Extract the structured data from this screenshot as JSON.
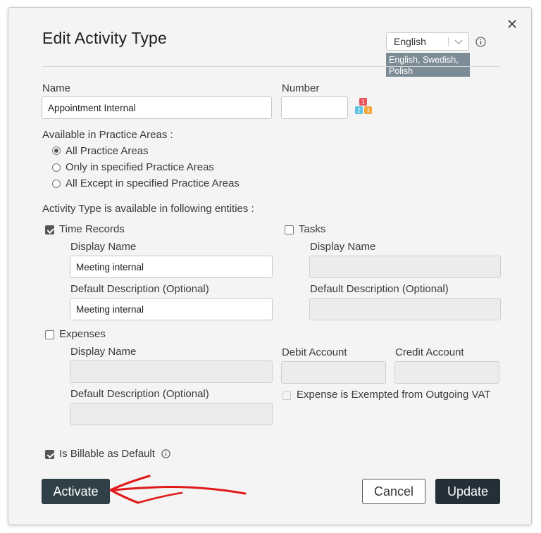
{
  "dialog": {
    "title": "Edit Activity Type",
    "language": {
      "selected": "English",
      "tooltip": "English, Swedish, Polish"
    },
    "name": {
      "label": "Name",
      "value": "Appointment Internal"
    },
    "number": {
      "label": "Number",
      "value": ""
    },
    "practice_areas": {
      "label": "Available in Practice Areas :",
      "options": [
        "All Practice Areas",
        "Only in specified Practice Areas",
        "All Except in specified Practice Areas"
      ],
      "selected_index": 0
    },
    "entities_label": "Activity Type is available in following entities :",
    "time_records": {
      "label": "Time Records",
      "checked": true,
      "display_name_label": "Display Name",
      "display_name_value": "Meeting internal",
      "default_desc_label": "Default Description (Optional)",
      "default_desc_value": "Meeting internal"
    },
    "tasks": {
      "label": "Tasks",
      "checked": false,
      "display_name_label": "Display Name",
      "default_desc_label": "Default Description (Optional)"
    },
    "expenses": {
      "label": "Expenses",
      "checked": false,
      "display_name_label": "Display Name",
      "default_desc_label": "Default Description (Optional)",
      "debit_account_label": "Debit Account",
      "credit_account_label": "Credit Account",
      "vat_exempt_label": "Expense is Exempted from Outgoing VAT"
    },
    "billable": {
      "label": "Is Billable as Default",
      "checked": true
    },
    "buttons": {
      "activate": "Activate",
      "cancel": "Cancel",
      "update": "Update"
    }
  },
  "colors": {
    "primary_dark": "#2f4049",
    "update_button": "#243038",
    "annotation_arrow": "#e01919",
    "tooltip_bg": "#7c8c96"
  },
  "icons": {
    "close": "close-icon",
    "language_dropdown": "chevron-down-icon",
    "info": "info-icon",
    "number_generator": "number-blocks-icon",
    "annotation": "red-arrow-annotation"
  }
}
